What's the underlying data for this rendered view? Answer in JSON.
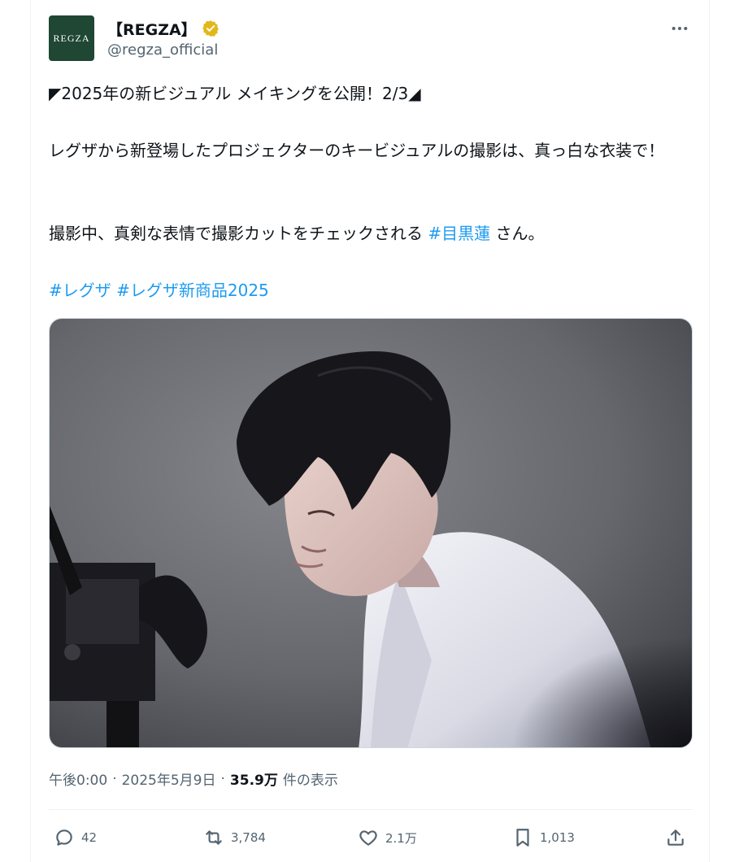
{
  "author": {
    "avatar_text": "REGZA",
    "display_name": "【REGZA】",
    "handle": "@regza_official",
    "verified_badge_color": "#e2b719"
  },
  "post": {
    "line1": "◤2025年の新ビジュアル メイキングを公開！2/3◢",
    "line2": "レグザから新登場したプロジェクターのキービジュアルの撮影は、真っ白な衣装で！",
    "line3_prefix": "撮影中、真剣な表情で撮影カットをチェックされる ",
    "line3_mention": "#目黒蓮",
    "line3_suffix": " さん。",
    "hashtag1": "#レグザ",
    "hashtag2": "#レグザ新商品2025"
  },
  "meta": {
    "time": "午後0:00",
    "sep1": "·",
    "date": "2025年5月9日",
    "sep2": "·",
    "views_number": "35.9万",
    "views_label": "件の表示"
  },
  "actions": {
    "replies": "42",
    "reposts": "3,784",
    "likes": "2.1万",
    "bookmarks": "1,013"
  },
  "colors": {
    "link": "#1d9bf0",
    "muted": "#536471",
    "text": "#0f1419",
    "avatar_bg": "#1f4733"
  },
  "icons": [
    "more-icon",
    "verified-icon",
    "reply-icon",
    "repost-icon",
    "like-icon",
    "bookmark-icon",
    "share-icon"
  ]
}
